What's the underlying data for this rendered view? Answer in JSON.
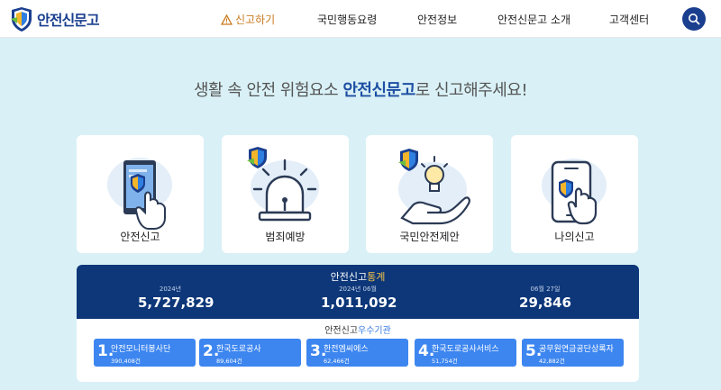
{
  "header": {
    "logo_text": "안전신문고",
    "nav": [
      {
        "label": "신고하기",
        "active": true
      },
      {
        "label": "국민행동요령"
      },
      {
        "label": "안전정보"
      },
      {
        "label": "안전신문고 소개"
      },
      {
        "label": "고객센터"
      }
    ],
    "search_icon": "search-icon"
  },
  "hero": {
    "text_before": "생활 속 안전 위험요소 ",
    "text_highlight": "안전신문고",
    "text_after": "로 신고해주세요!"
  },
  "cards": [
    {
      "label": "안전신고",
      "icon": "phone-touch-icon"
    },
    {
      "label": "범죄예방",
      "icon": "siren-icon"
    },
    {
      "label": "국민안전제안",
      "icon": "idea-hand-icon"
    },
    {
      "label": "나의신고",
      "icon": "my-phone-icon"
    }
  ],
  "stats": {
    "title_prefix": "안전신고",
    "title_highlight": "통계",
    "items": [
      {
        "caption": "2024년",
        "value": "5,727,829"
      },
      {
        "caption": "2024년 06월",
        "value": "1,011,092"
      },
      {
        "caption": "06월 27일",
        "value": "29,846"
      }
    ]
  },
  "orgs": {
    "title_prefix": "안전신고",
    "title_highlight": "우수기관",
    "items": [
      {
        "num": "1.",
        "name": "안전모니터봉사단",
        "count": "390,408건"
      },
      {
        "num": "2.",
        "name": "한국도로공사",
        "count": "89,604건"
      },
      {
        "num": "3.",
        "name": "한전엠씨에스",
        "count": "62,466건"
      },
      {
        "num": "4.",
        "name": "한국도로공사서비스",
        "count": "51,754건"
      },
      {
        "num": "5.",
        "name": "공무원연금공단상록자",
        "count": "42,882건"
      }
    ]
  },
  "colors": {
    "brand_navy": "#0d3779",
    "accent_orange": "#c97a1e",
    "org_blue": "#3d86f0",
    "bg": "#d9f1f6"
  }
}
